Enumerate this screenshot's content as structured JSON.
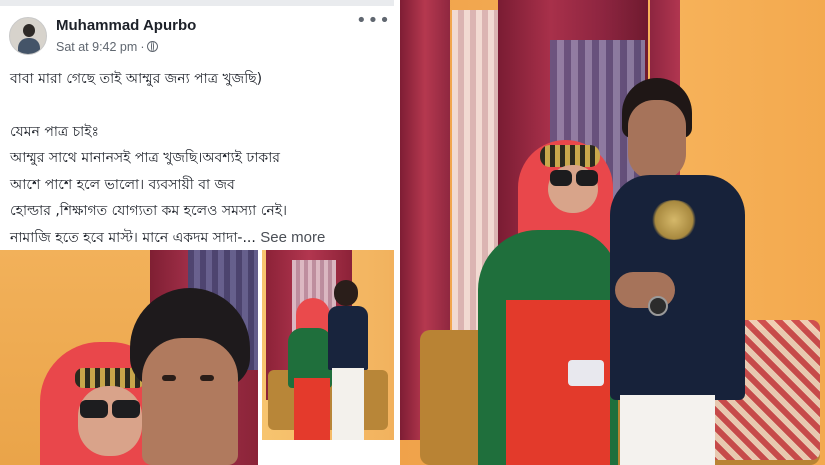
{
  "post": {
    "author": "Muhammad Apurbo",
    "timestamp": "Sat at 9:42 pm",
    "separator": "·",
    "privacy_icon": "globe-icon",
    "more_icon": "•••",
    "lines": [
      "বাবা মারা গেছে তাই আম্মুর জন্য পাত্র খুজছি)",
      "",
      "যেমন পাত্র চাইঃ",
      "আম্মুর সাথে মানানসই  পাত্র খুজছি।অবশ্যই  ঢাকার",
      "আশে পাশে হলে ভালো। ব্যবসায়ী বা জব",
      "হোল্ডার ,শিক্ষাগত যোগ্যতা কম হলেও সমস্যা নেই।",
      "নামাজি হতে হবে মাস্ট। মানে একদম সাদা-..."
    ],
    "see_more": "See more"
  },
  "colors": {
    "author": "#1d2129",
    "meta": "#606770",
    "wall_orange": "#f2a94c",
    "curtain": "#a02a3f",
    "hijab": "#ea4a4c",
    "dress_green": "#1f6f3c",
    "skirt_red": "#e43a2c",
    "shirt_navy": "#18243d"
  }
}
